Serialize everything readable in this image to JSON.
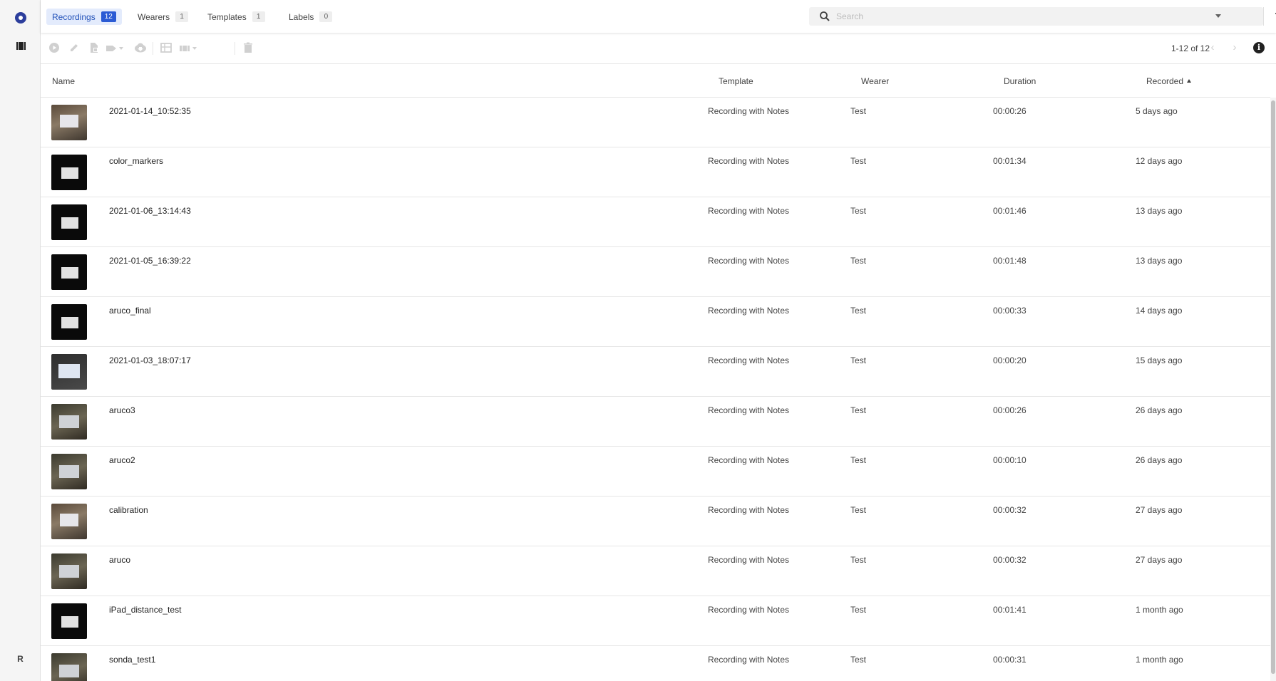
{
  "tabs": [
    {
      "label": "Recordings",
      "count": "12"
    },
    {
      "label": "Wearers",
      "count": "1"
    },
    {
      "label": "Templates",
      "count": "1"
    },
    {
      "label": "Labels",
      "count": "0"
    }
  ],
  "search": {
    "placeholder": "Search",
    "value": ""
  },
  "pager": {
    "text": "1-12 of 12"
  },
  "user_initial": "R",
  "columns": {
    "name": "Name",
    "template": "Template",
    "wearer": "Wearer",
    "duration": "Duration",
    "recorded": "Recorded"
  },
  "sort": {
    "column": "Recorded",
    "direction": "ascending"
  },
  "rows": [
    {
      "name": "2021-01-14_10:52:35",
      "template": "Recording with Notes",
      "wearer": "Test",
      "duration": "00:00:26",
      "recorded": "5 days ago",
      "thumb": "bright"
    },
    {
      "name": "color_markers",
      "template": "Recording with Notes",
      "wearer": "Test",
      "duration": "00:01:34",
      "recorded": "12 days ago",
      "thumb": "dark"
    },
    {
      "name": "2021-01-06_13:14:43",
      "template": "Recording with Notes",
      "wearer": "Test",
      "duration": "00:01:46",
      "recorded": "13 days ago",
      "thumb": "dark"
    },
    {
      "name": "2021-01-05_16:39:22",
      "template": "Recording with Notes",
      "wearer": "Test",
      "duration": "00:01:48",
      "recorded": "13 days ago",
      "thumb": "dark"
    },
    {
      "name": "aruco_final",
      "template": "Recording with Notes",
      "wearer": "Test",
      "duration": "00:00:33",
      "recorded": "14 days ago",
      "thumb": "dark"
    },
    {
      "name": "2021-01-03_18:07:17",
      "template": "Recording with Notes",
      "wearer": "Test",
      "duration": "00:00:20",
      "recorded": "15 days ago",
      "thumb": "screen"
    },
    {
      "name": "aruco3",
      "template": "Recording with Notes",
      "wearer": "Test",
      "duration": "00:00:26",
      "recorded": "26 days ago",
      "thumb": "room"
    },
    {
      "name": "aruco2",
      "template": "Recording with Notes",
      "wearer": "Test",
      "duration": "00:00:10",
      "recorded": "26 days ago",
      "thumb": "room"
    },
    {
      "name": "calibration",
      "template": "Recording with Notes",
      "wearer": "Test",
      "duration": "00:00:32",
      "recorded": "27 days ago",
      "thumb": "bright"
    },
    {
      "name": "aruco",
      "template": "Recording with Notes",
      "wearer": "Test",
      "duration": "00:00:32",
      "recorded": "27 days ago",
      "thumb": "room"
    },
    {
      "name": "iPad_distance_test",
      "template": "Recording with Notes",
      "wearer": "Test",
      "duration": "00:01:41",
      "recorded": "1 month ago",
      "thumb": "dark"
    },
    {
      "name": "sonda_test1",
      "template": "Recording with Notes",
      "wearer": "Test",
      "duration": "00:00:31",
      "recorded": "1 month ago",
      "thumb": "room"
    }
  ],
  "colors": {
    "accent": "#2b5bd4",
    "tab_active_bg": "#e3ebfc",
    "logo": "#2c3e9c"
  }
}
